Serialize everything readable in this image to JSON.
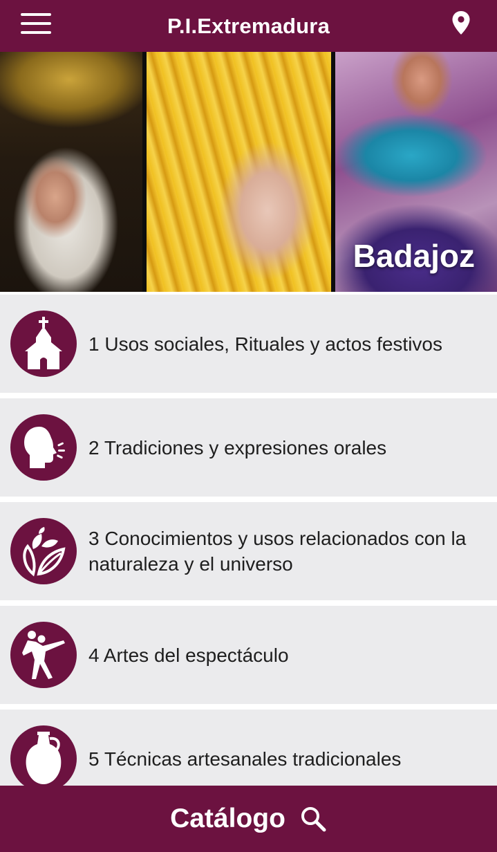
{
  "header": {
    "title": "P.I.Extremadura",
    "menu_icon": "menu-icon",
    "location_icon": "location-pin-icon"
  },
  "banner": {
    "label": "Badajoz"
  },
  "categories": [
    {
      "label": "1 Usos sociales, Rituales y actos festivos",
      "icon": "chapel-icon"
    },
    {
      "label": "2 Tradiciones y expresiones orales",
      "icon": "speaking-head-icon"
    },
    {
      "label": "3 Conocimientos y usos relacionados con la naturaleza y el universo",
      "icon": "leaves-icon"
    },
    {
      "label": "4 Artes del espectáculo",
      "icon": "dancers-icon"
    },
    {
      "label": "5 Técnicas artesanales tradicionales",
      "icon": "jug-icon"
    }
  ],
  "footer": {
    "label": "Catálogo",
    "icon": "search-icon"
  },
  "colors": {
    "brand": "#6c1240",
    "item_background": "#ebebed",
    "text": "#1e1e1e"
  }
}
